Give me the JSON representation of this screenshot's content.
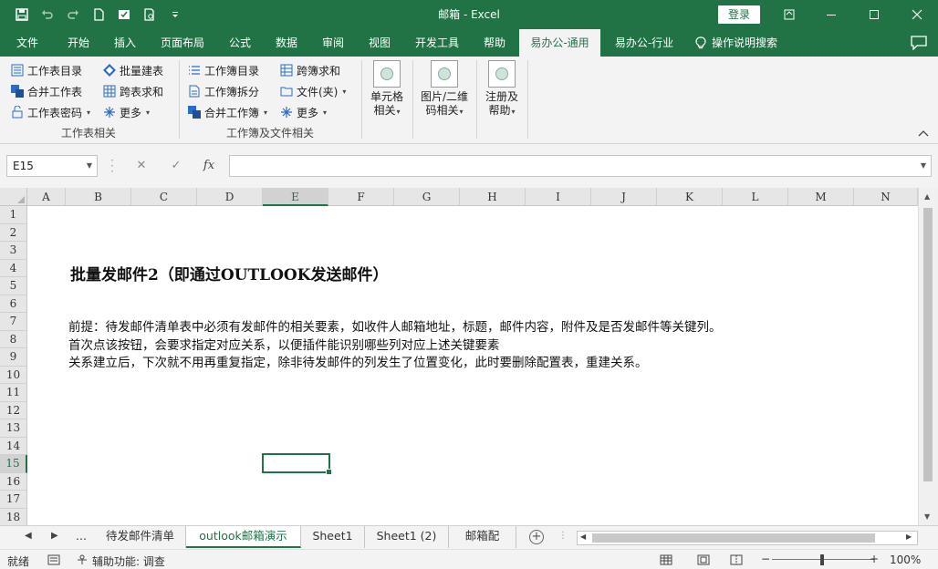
{
  "window": {
    "title": "邮箱 - Excel",
    "login_label": "登录"
  },
  "qat": {
    "icons": [
      "save-icon",
      "undo-icon",
      "redo-icon",
      "new-file-icon",
      "touch-mode-icon",
      "print-preview-icon",
      "customize-icon"
    ]
  },
  "tabs": [
    {
      "label": "文件"
    },
    {
      "label": "开始"
    },
    {
      "label": "插入"
    },
    {
      "label": "页面布局"
    },
    {
      "label": "公式"
    },
    {
      "label": "数据"
    },
    {
      "label": "审阅"
    },
    {
      "label": "视图"
    },
    {
      "label": "开发工具"
    },
    {
      "label": "帮助"
    },
    {
      "label": "易办公-通用",
      "active": true
    },
    {
      "label": "易办公-行业"
    },
    {
      "label": "操作说明搜索"
    }
  ],
  "ribbon": {
    "group1": {
      "label": "工作表相关",
      "items": [
        {
          "label": "工作表目录"
        },
        {
          "label": "批量建表"
        },
        {
          "label": "合并工作表"
        },
        {
          "label": "跨表求和"
        },
        {
          "label": "工作表密码"
        },
        {
          "label": "更多"
        }
      ]
    },
    "group2": {
      "label": "工作簿及文件相关",
      "items": [
        {
          "label": "工作簿目录"
        },
        {
          "label": "跨簿求和"
        },
        {
          "label": "工作簿拆分"
        },
        {
          "label": "文件(夹)"
        },
        {
          "label": "合并工作簿"
        },
        {
          "label": "更多"
        }
      ]
    },
    "big": [
      {
        "line1": "单元格",
        "line2": "相关"
      },
      {
        "line1": "图片/二维",
        "line2": "码相关"
      },
      {
        "line1": "注册及",
        "line2": "帮助"
      }
    ]
  },
  "formula": {
    "namebox": "E15",
    "value": ""
  },
  "grid": {
    "columns": [
      "A",
      "B",
      "C",
      "D",
      "E",
      "F",
      "G",
      "H",
      "I",
      "J",
      "K",
      "L",
      "M",
      "N"
    ],
    "selected_column": "E",
    "rows": [
      "1",
      "2",
      "3",
      "4",
      "5",
      "6",
      "7",
      "8",
      "9",
      "10",
      "11",
      "12",
      "13",
      "14",
      "15",
      "16",
      "17",
      "18"
    ],
    "selected_row": "15"
  },
  "content": {
    "title": "批量发邮件2（即通过OUTLOOK发送邮件）",
    "line7": "前提：待发邮件清单表中必须有发邮件的相关要素，如收件人邮箱地址，标题，邮件内容，附件及是否发邮件等关键列。",
    "line8": "首次点该按钮，会要求指定对应关系，以便插件能识别哪些列对应上述关键要素",
    "line9": "关系建立后，下次就不用再重复指定，除非待发邮件的列发生了位置变化，此时要删除配置表，重建关系。"
  },
  "sheets": {
    "more": "...",
    "tabs": [
      {
        "label": "待发邮件清单"
      },
      {
        "label": "outlook邮箱演示",
        "active": true
      },
      {
        "label": "Sheet1"
      },
      {
        "label": "Sheet1 (2)"
      },
      {
        "label": "邮箱配"
      }
    ]
  },
  "status": {
    "ready": "就绪",
    "accessibility": "辅助功能: 调查",
    "zoom": "100%"
  }
}
